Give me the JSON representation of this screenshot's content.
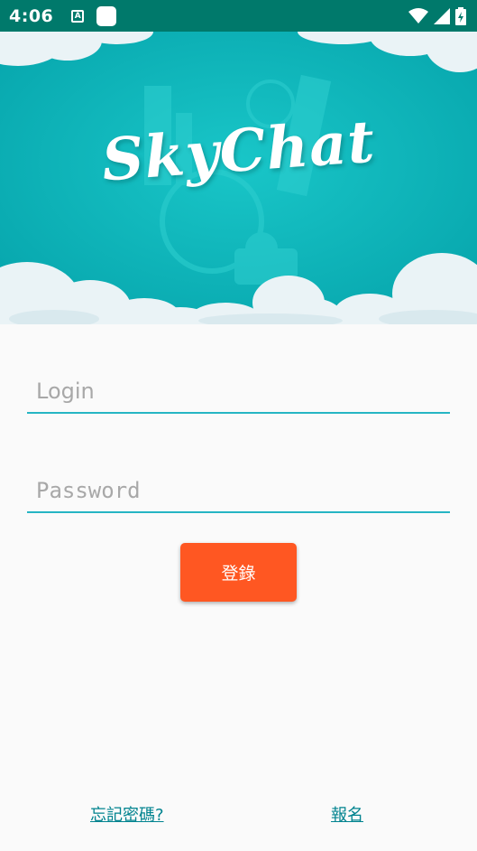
{
  "status_bar": {
    "time": "4:06",
    "notification_icon_letter": "A",
    "icons": [
      "a-notification-icon",
      "app-notification-icon",
      "wifi-icon",
      "signal-icon",
      "battery-icon"
    ]
  },
  "banner": {
    "logo_text": "SkyChat",
    "colors": {
      "teal": "#0BB3B8",
      "cloud": "#EAF3F6"
    }
  },
  "form": {
    "login_placeholder": "Login",
    "password_placeholder": "Password",
    "login_button_label": "登錄"
  },
  "links": {
    "forgot_password": "忘記密碼?",
    "signup": "報名"
  },
  "colors": {
    "status_bar": "#00796B",
    "accent": "#26B5C4",
    "button": "#FF5722",
    "link": "#00838F",
    "background": "#FAFAFA"
  }
}
